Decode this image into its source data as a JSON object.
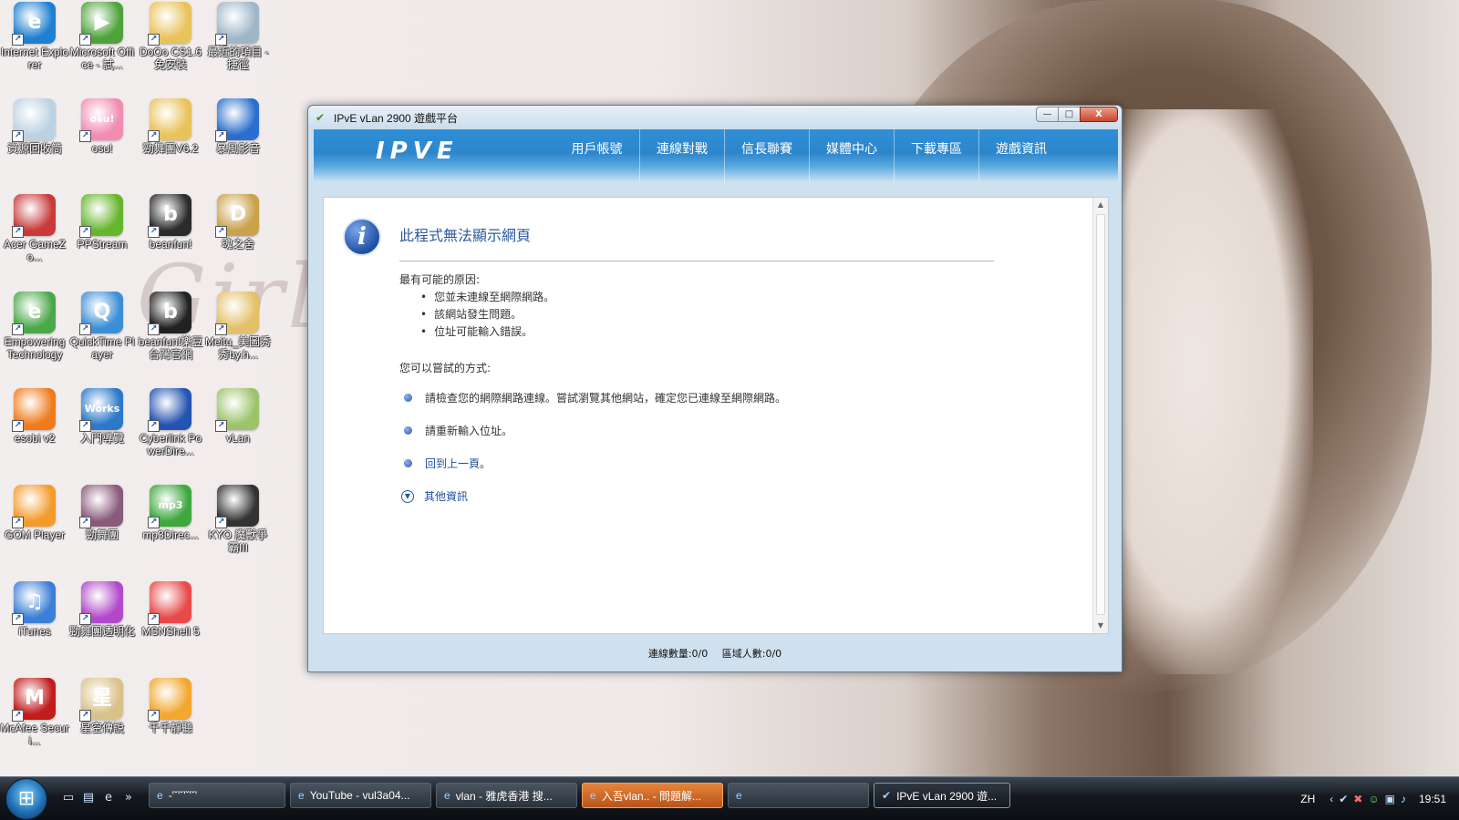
{
  "desktop": {
    "icons": [
      {
        "label": "Internet Explorer",
        "glyph": "e",
        "color": "#1f7fd1"
      },
      {
        "label": "Microsoft Office - 試...",
        "glyph": "▶",
        "color": "#4fa33a"
      },
      {
        "label": "DoOo CS1.6 免安裝",
        "glyph": "",
        "color": "#e8c25a"
      },
      {
        "label": "最近的項目 - 捷徑",
        "glyph": "",
        "color": "#9fb6c8"
      },
      {
        "label": "資源回收筒",
        "glyph": "",
        "color": "#bcd2e2"
      },
      {
        "label": "osu!",
        "glyph": "osu!",
        "color": "#f28cb3"
      },
      {
        "label": "勁舞團V6.2",
        "glyph": "",
        "color": "#e8c25a"
      },
      {
        "label": "暴風影音",
        "glyph": "",
        "color": "#2a6fcf"
      },
      {
        "label": "Acer GameZo...",
        "glyph": "",
        "color": "#c73a3a"
      },
      {
        "label": "PPStream",
        "glyph": "",
        "color": "#66b62c"
      },
      {
        "label": "beanfun!",
        "glyph": "b",
        "color": "#2b2b2b"
      },
      {
        "label": "魂之舍",
        "glyph": "D",
        "color": "#c9a24a"
      },
      {
        "label": "Empowering Technology",
        "glyph": "e",
        "color": "#4aa84a"
      },
      {
        "label": "QuickTime Player",
        "glyph": "Q",
        "color": "#3b8fd6"
      },
      {
        "label": "beanfun!樂豆台灣官網",
        "glyph": "b",
        "color": "#222"
      },
      {
        "label": "Meitu_美圖秀秀by.h...",
        "glyph": "",
        "color": "#e4c068"
      },
      {
        "label": "esobi v2",
        "glyph": "",
        "color": "#f07b1e"
      },
      {
        "label": "入門導覽",
        "glyph": "Works",
        "color": "#2c79c9"
      },
      {
        "label": "Cyberlink PowerDire...",
        "glyph": "",
        "color": "#2554b0"
      },
      {
        "label": "vLan",
        "glyph": "",
        "color": "#9cc36a"
      },
      {
        "label": "GOM Player",
        "glyph": "",
        "color": "#f39a2b"
      },
      {
        "label": "勁舞團",
        "glyph": "",
        "color": "#8a5a7a"
      },
      {
        "label": "mp3Direc...",
        "glyph": "mp3",
        "color": "#3ea83e"
      },
      {
        "label": "KYO 魔獸爭霸III",
        "glyph": "",
        "color": "#333"
      },
      {
        "label": "iTunes",
        "glyph": "♫",
        "color": "#3b7fd6"
      },
      {
        "label": "勁舞團透明化",
        "glyph": "",
        "color": "#b04ac9"
      },
      {
        "label": "MSNShell 5",
        "glyph": "",
        "color": "#e64a4a"
      },
      {
        "label": "",
        "glyph": "",
        "color": "#ffffff"
      },
      {
        "label": "McAfee Securi...",
        "glyph": "M",
        "color": "#c21c1c"
      },
      {
        "label": "星空傳說",
        "glyph": "星",
        "color": "#d9c28a"
      },
      {
        "label": "千千靜聽",
        "glyph": "",
        "color": "#f2a72e"
      }
    ]
  },
  "window": {
    "title": "IPvE vLan 2900 遊戲平台",
    "buttons": {
      "minimize": "—",
      "maximize": "□",
      "close": "X"
    },
    "logo": "IPVE",
    "nav": [
      "用戶帳號",
      "連線對戰",
      "信長聯賽",
      "媒體中心",
      "下載專區",
      "遊戲資訊"
    ],
    "content": {
      "title": "此程式無法顯示網頁",
      "reasons_label": "最有可能的原因:",
      "reasons": [
        "您並未連線至網際網路。",
        "該網站發生問題。",
        "位址可能輸入錯誤。"
      ],
      "try_label": "您可以嘗試的方式:",
      "tips": [
        "請檢查您的網際網路連線。嘗試瀏覽其他網站，確定您已連線至網際網路。",
        "請重新輸入位址。"
      ],
      "back_link": "回到上一頁",
      "back_suffix": "。",
      "more_info": "其他資訊"
    },
    "status": {
      "connections": "連線數量:0/0",
      "region": "區域人數:0/0"
    }
  },
  "taskbar": {
    "tasks": [
      {
        "label": "-'ˇ'ˇ'ˇ'ˇ'",
        "state": "normal"
      },
      {
        "label": "YouTube - vul3a04...",
        "state": "normal"
      },
      {
        "label": "vlan - 雅虎香港 搜...",
        "state": "normal"
      },
      {
        "label": "入吾vlan.. - 問題解...",
        "state": "flash"
      },
      {
        "label": "",
        "state": "normal"
      },
      {
        "label": "IPvE vLan 2900 遊...",
        "state": "active"
      }
    ],
    "language": "ZH",
    "clock": "19:51"
  }
}
